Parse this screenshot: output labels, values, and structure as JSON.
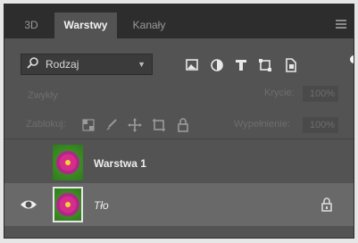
{
  "tabs": [
    {
      "label": "3D",
      "active": false
    },
    {
      "label": "Warstwy",
      "active": true
    },
    {
      "label": "Kanały",
      "active": false
    }
  ],
  "filter": {
    "label": "Rodzaj",
    "icons": [
      "image-filter-icon",
      "adjustment-filter-icon",
      "type-filter-icon",
      "shape-filter-icon",
      "smart-object-filter-icon"
    ]
  },
  "blend": {
    "mode": "Zwykły"
  },
  "opacity": {
    "label": "Krycie:",
    "value": "100%"
  },
  "lock": {
    "label": "Zablokuj:",
    "icons": [
      "lock-transparent-icon",
      "lock-paint-icon",
      "lock-position-icon",
      "lock-artboard-icon",
      "lock-all-icon"
    ]
  },
  "fill": {
    "label": "Wypełnienie:",
    "value": "100%"
  },
  "layers": [
    {
      "name": "Warstwa 1",
      "visible": false,
      "selected": false,
      "locked": false
    },
    {
      "name": "Tło",
      "visible": true,
      "selected": true,
      "locked": true
    }
  ],
  "colors": {
    "panel": "#535353",
    "tabbar": "#2d2d2d",
    "selected_layer": "#696969"
  }
}
